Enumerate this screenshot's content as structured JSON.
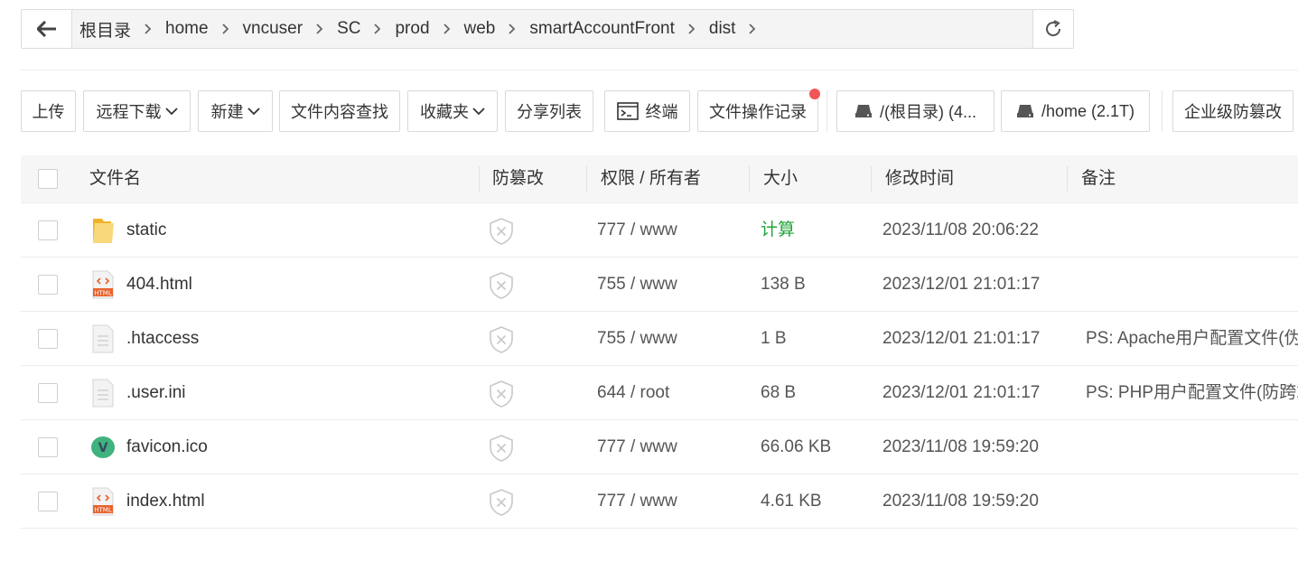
{
  "breadcrumb": {
    "items": [
      "根目录",
      "home",
      "vncuser",
      "SC",
      "prod",
      "web",
      "smartAccountFront",
      "dist"
    ]
  },
  "toolbar": {
    "upload": "上传",
    "remote_download": "远程下载",
    "new": "新建",
    "find_in_files": "文件内容查找",
    "favorites": "收藏夹",
    "share_list": "分享列表",
    "terminal": "终端",
    "file_log": "文件操作记录",
    "disk_root": "/(根目录) (4...",
    "disk_home": "/home (2.1T)",
    "tamper_proof": "企业级防篡改"
  },
  "table": {
    "headers": {
      "name": "文件名",
      "tamper": "防篡改",
      "perm_owner": "权限 / 所有者",
      "size": "大小",
      "mtime": "修改时间",
      "note": "备注"
    },
    "rows": [
      {
        "name": "static",
        "icon": "folder-icon",
        "perm": "777 / www",
        "size": "计算",
        "mtime": "2023/11/08 20:06:22",
        "note": ""
      },
      {
        "name": "404.html",
        "icon": "html-file-icon",
        "perm": "755 / www",
        "size": "138 B",
        "mtime": "2023/12/01 21:01:17",
        "note": ""
      },
      {
        "name": ".htaccess",
        "icon": "text-file-icon",
        "perm": "755 / www",
        "size": "1 B",
        "mtime": "2023/12/01 21:01:17",
        "note": "PS: Apache用户配置文件(伪静"
      },
      {
        "name": ".user.ini",
        "icon": "text-file-icon",
        "perm": "644 / root",
        "size": "68 B",
        "mtime": "2023/12/01 21:01:17",
        "note": "PS: PHP用户配置文件(防跨站"
      },
      {
        "name": "favicon.ico",
        "icon": "vue-logo-icon",
        "perm": "777 / www",
        "size": "66.06 KB",
        "mtime": "2023/11/08 19:59:20",
        "note": ""
      },
      {
        "name": "index.html",
        "icon": "html-file-icon",
        "perm": "777 / www",
        "size": "4.61 KB",
        "mtime": "2023/11/08 19:59:20",
        "note": ""
      }
    ]
  },
  "icons": {
    "html_badge": "HTML",
    "vue_letter": "V"
  },
  "colors": {
    "accent_green": "#20a53a",
    "notice_red": "#f25556",
    "folder_yellow": "#f5c842",
    "html_orange": "#e8622c"
  }
}
